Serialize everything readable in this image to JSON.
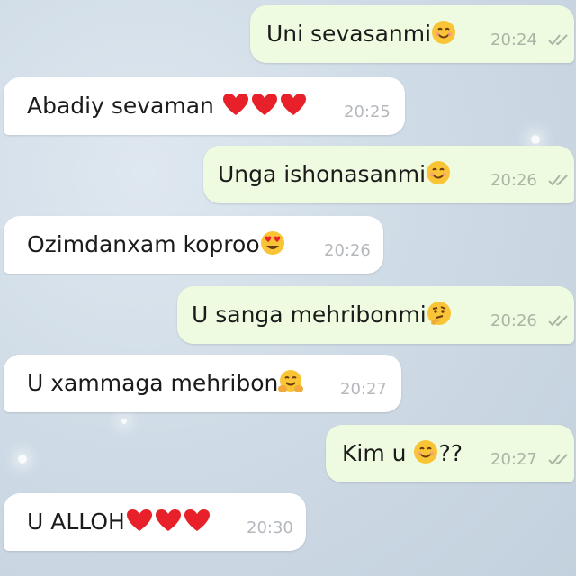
{
  "chat": {
    "messages": [
      {
        "direction": "outgoing",
        "text": "Uni sevasanmi",
        "emoji": "smiling-face-icon",
        "time": "20:24",
        "status": "read"
      },
      {
        "direction": "incoming",
        "text": "Abadiy sevaman ",
        "emoji": "red-heart-icon x3",
        "time": "20:25"
      },
      {
        "direction": "outgoing",
        "text": "Unga ishonasanmi",
        "emoji": "smiling-face-icon",
        "time": "20:26",
        "status": "read"
      },
      {
        "direction": "incoming",
        "text": "Ozimdanxam koproo",
        "emoji": "heart-eyes-icon",
        "time": "20:26"
      },
      {
        "direction": "outgoing",
        "text": "U sanga mehribonmi",
        "emoji": "thinking-face-icon",
        "time": "20:26",
        "status": "read"
      },
      {
        "direction": "incoming",
        "text": "U xammaga mehribon",
        "emoji": "hugging-face-icon",
        "time": "20:27"
      },
      {
        "direction": "outgoing",
        "text_before": "Kim u ",
        "emoji": "smiling-face-icon",
        "text_after": "??",
        "time": "20:27",
        "status": "read"
      },
      {
        "direction": "incoming",
        "text": "U ALLOH",
        "emoji": "red-heart-icon x3",
        "time": "20:30"
      }
    ]
  },
  "colors": {
    "outgoing_bubble": "#eefbe0",
    "incoming_bubble": "#ffffff",
    "background": "#cfdbe6",
    "outgoing_time": "#a8b6a6",
    "read_check": "#a8b6a6"
  }
}
